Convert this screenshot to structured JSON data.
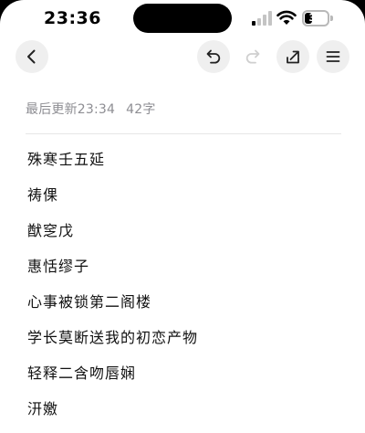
{
  "status_bar": {
    "time": "23:36",
    "battery_level": "35",
    "battery_fraction": 0.35
  },
  "toolbar": {
    "back_icon": "chevron-left-icon",
    "undo_icon": "undo-icon",
    "redo_icon": "redo-icon",
    "share_icon": "share-icon",
    "menu_icon": "menu-icon"
  },
  "note": {
    "last_updated": "最后更新23:34",
    "word_count": "42字",
    "lines": [
      "殊寒壬五延",
      "祷倮",
      "猷窆戊",
      "惠恬缪子",
      "心事被锁第二阁楼",
      "学长莫断送我的初恋产物",
      "轻释二含吻唇娴",
      "汧嬓"
    ]
  }
}
